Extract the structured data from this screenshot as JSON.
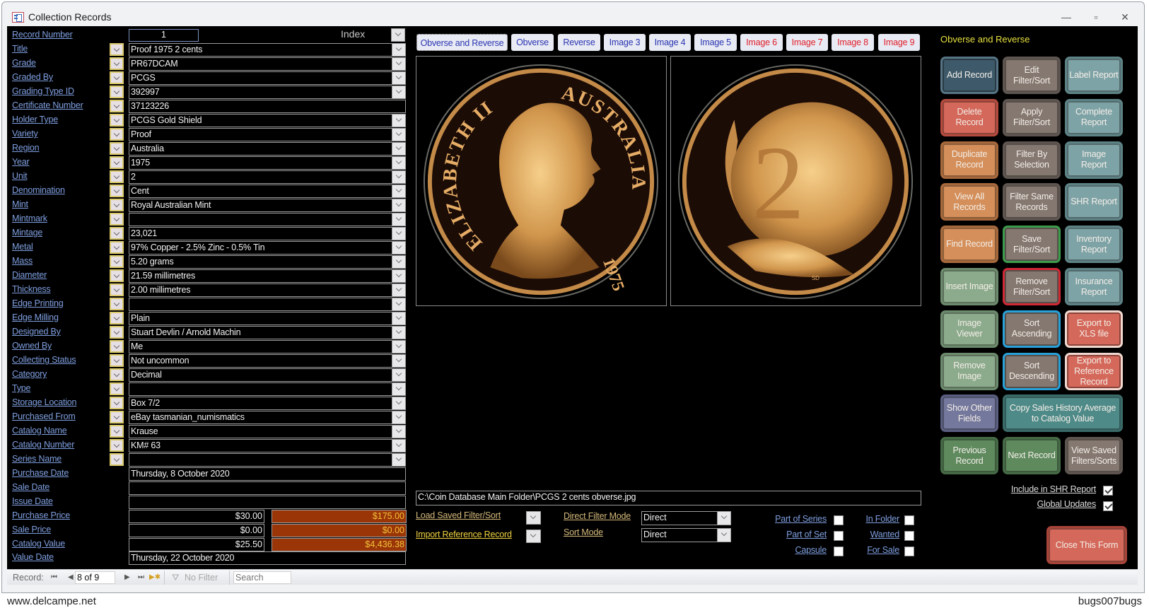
{
  "window": {
    "title": "Collection Records",
    "controls": {
      "minimize": "—",
      "maximize": "▫",
      "close": "✕"
    }
  },
  "record_number": {
    "label": "Record  Number",
    "value": "1"
  },
  "index": {
    "label": "Index"
  },
  "fields": [
    {
      "label": "Title",
      "value": "Proof 1975 2 cents",
      "lookup": true,
      "combo": true
    },
    {
      "label": "Grade",
      "value": "PR67DCAM",
      "lookup": true,
      "combo": true
    },
    {
      "label": "Graded By",
      "value": "PCGS",
      "lookup": true,
      "combo": true
    },
    {
      "label": "Grading Type ID",
      "value": "392997",
      "lookup": true,
      "combo": true
    },
    {
      "label": "Certificate Number",
      "value": "37123226",
      "lookup": true,
      "combo": false
    },
    {
      "label": "Holder Type",
      "value": "PCGS Gold Shield",
      "lookup": true,
      "combo": true
    },
    {
      "label": "Variety",
      "value": "Proof",
      "lookup": true,
      "combo": true
    },
    {
      "label": "Region",
      "value": "Australia",
      "lookup": true,
      "combo": true
    },
    {
      "label": "Year",
      "value": "1975",
      "lookup": true,
      "combo": true
    },
    {
      "label": "Unit",
      "value": "2",
      "lookup": true,
      "combo": true
    },
    {
      "label": "Denomination",
      "value": "Cent",
      "lookup": true,
      "combo": true
    },
    {
      "label": "Mint",
      "value": "Royal Australian Mint",
      "lookup": true,
      "combo": true
    },
    {
      "label": "Mintmark",
      "value": "",
      "lookup": true,
      "combo": true
    },
    {
      "label": "Mintage",
      "value": "23,021",
      "lookup": true,
      "combo": true
    },
    {
      "label": "Metal",
      "value": "97% Copper - 2.5% Zinc - 0.5% Tin",
      "lookup": true,
      "combo": true
    },
    {
      "label": "Mass",
      "value": "5.20 grams",
      "lookup": true,
      "combo": true
    },
    {
      "label": "Diameter",
      "value": "21.59 millimetres",
      "lookup": true,
      "combo": true
    },
    {
      "label": "Thickness",
      "value": "2.00 millimetres",
      "lookup": true,
      "combo": true
    },
    {
      "label": "Edge Printing",
      "value": "",
      "lookup": true,
      "combo": true
    },
    {
      "label": "Edge Milling",
      "value": "Plain",
      "lookup": true,
      "combo": true
    },
    {
      "label": "Designed By",
      "value": "Stuart Devlin / Arnold Machin",
      "lookup": true,
      "combo": true
    },
    {
      "label": "Owned By",
      "value": "Me",
      "lookup": true,
      "combo": true
    },
    {
      "label": "Collecting Status",
      "value": "Not uncommon",
      "lookup": true,
      "combo": true
    },
    {
      "label": "Category",
      "value": "Decimal",
      "lookup": true,
      "combo": true
    },
    {
      "label": "Type",
      "value": "",
      "lookup": true,
      "combo": true
    },
    {
      "label": "Storage Location",
      "value": "Box 7/2",
      "lookup": true,
      "combo": true
    },
    {
      "label": "Purchased From",
      "value": "eBay tasmanian_numismatics",
      "lookup": true,
      "combo": true
    },
    {
      "label": "Catalog Name",
      "value": "Krause",
      "lookup": true,
      "combo": true
    },
    {
      "label": "Catalog Number",
      "value": "KM# 63",
      "lookup": true,
      "combo": true
    },
    {
      "label": "Series Name",
      "value": "",
      "lookup": true,
      "combo": true
    },
    {
      "label": "Purchase Date",
      "value": "Thursday, 8 October 2020",
      "lookup": false,
      "combo": false
    },
    {
      "label": "Sale Date",
      "value": "",
      "lookup": false,
      "combo": false
    },
    {
      "label": "Issue Date",
      "value": "",
      "lookup": false,
      "combo": false
    }
  ],
  "prices": [
    {
      "label": "Purchase Price",
      "value": "$30.00",
      "total": "$175.00"
    },
    {
      "label": "Sale Price",
      "value": "$0.00",
      "total": "$0.00"
    },
    {
      "label": "Catalog Value",
      "value": "$25.50",
      "total": "$4,436.38"
    }
  ],
  "value_date": {
    "label": "Value Date",
    "value": "Thursday, 22 October 2020"
  },
  "tabs": [
    {
      "label": "Obverse and Reverse",
      "active": true,
      "color": "blue"
    },
    {
      "label": "Obverse",
      "color": "blue"
    },
    {
      "label": "Reverse",
      "color": "blue"
    },
    {
      "label": "Image 3",
      "color": "blue"
    },
    {
      "label": "Image 4",
      "color": "blue"
    },
    {
      "label": "Image 5",
      "color": "blue"
    },
    {
      "label": "Image 6",
      "color": "red"
    },
    {
      "label": "Image 7",
      "color": "red"
    },
    {
      "label": "Image 8",
      "color": "red"
    },
    {
      "label": "Image 9",
      "color": "red"
    }
  ],
  "images": {
    "obverse": {
      "legend_left": "ELIZABETH II",
      "legend_right": "AUSTRALIA",
      "year": "1975"
    },
    "reverse": {
      "denomination": "2",
      "initials": "SD"
    }
  },
  "image_path": "C:\\Coin Database Main Folder\\PCGS 2 cents obverse.jpg",
  "filters": {
    "load_saved": "Load Saved Filter/Sort",
    "import_reference": "Import Reference Record",
    "direct_filter_mode_label": "Direct Filter Mode",
    "direct_filter_mode_value": "Direct",
    "sort_mode_label": "Sort Mode",
    "sort_mode_value": "Direct"
  },
  "flags": [
    {
      "label": "Part of Series",
      "checked": false
    },
    {
      "label": "Part of Set",
      "checked": false
    },
    {
      "label": "Capsule",
      "checked": false
    },
    {
      "label": "In Folder",
      "checked": false
    },
    {
      "label": "Wanted",
      "checked": false
    },
    {
      "label": "For Sale",
      "checked": false
    }
  ],
  "right_panel": {
    "title": "Obverse and Reverse",
    "buttons": [
      {
        "label": "Add Record",
        "style": "c-slate"
      },
      {
        "label": "Edit Filter/Sort",
        "style": "c-taupe"
      },
      {
        "label": "Label Report",
        "style": "c-teal"
      },
      {
        "label": "Delete Record",
        "style": "c-red"
      },
      {
        "label": "Apply Filter/Sort",
        "style": "c-taupe"
      },
      {
        "label": "Complete Report",
        "style": "c-teal"
      },
      {
        "label": "Duplicate Record",
        "style": "c-orange"
      },
      {
        "label": "Filter By Selection",
        "style": "c-taupe"
      },
      {
        "label": "Image Report",
        "style": "c-teal"
      },
      {
        "label": "View All Records",
        "style": "c-orange"
      },
      {
        "label": "Filter  Same Records",
        "style": "c-taupe"
      },
      {
        "label": "SHR Report",
        "style": "c-teal"
      },
      {
        "label": "Find Record",
        "style": "c-orange"
      },
      {
        "label": "Save Filter/Sort",
        "style": "c-taupe-green"
      },
      {
        "label": "Inventory Report",
        "style": "c-teal"
      },
      {
        "label": "Insert Image",
        "style": "c-green"
      },
      {
        "label": "Remove Filter/Sort",
        "style": "c-taupe-red"
      },
      {
        "label": "Insurance Report",
        "style": "c-teal"
      },
      {
        "label": "Image Viewer",
        "style": "c-green"
      },
      {
        "label": "Sort Ascending",
        "style": "c-taupe-blue"
      },
      {
        "label": "Export to XLS file",
        "style": "c-red-white"
      },
      {
        "label": "Remove Image",
        "style": "c-green"
      },
      {
        "label": "Sort Descending",
        "style": "c-taupe-blue"
      },
      {
        "label": "Export to Reference Record",
        "style": "c-red-white"
      },
      {
        "label": "Show Other Fields",
        "style": "c-purple"
      },
      {
        "label": "Copy Sales History Average to Catalog Value",
        "style": "c-dteal",
        "wide": true
      },
      {
        "label": "Previous Record",
        "style": "c-dgreen"
      },
      {
        "label": "Next Record",
        "style": "c-dgreen"
      },
      {
        "label": "View Saved Filters/Sorts",
        "style": "c-taupe"
      }
    ],
    "include_shr": {
      "label": "Include in SHR Report",
      "checked": true
    },
    "global_updates": {
      "label": "Global Updates",
      "checked": true
    },
    "close_button": "Close This Form"
  },
  "status_bar": {
    "record_label": "Record:",
    "position": "8 of 9",
    "filter": "No Filter",
    "search_placeholder": "Search"
  },
  "watermark": {
    "left": "www.delcampe.net",
    "right": "bugs007bugs"
  },
  "colors": {
    "label_blue": "#7f9fe0",
    "total_orange": "#9a3507",
    "total_text": "#f2c23a",
    "panel_title": "#e6e040"
  }
}
